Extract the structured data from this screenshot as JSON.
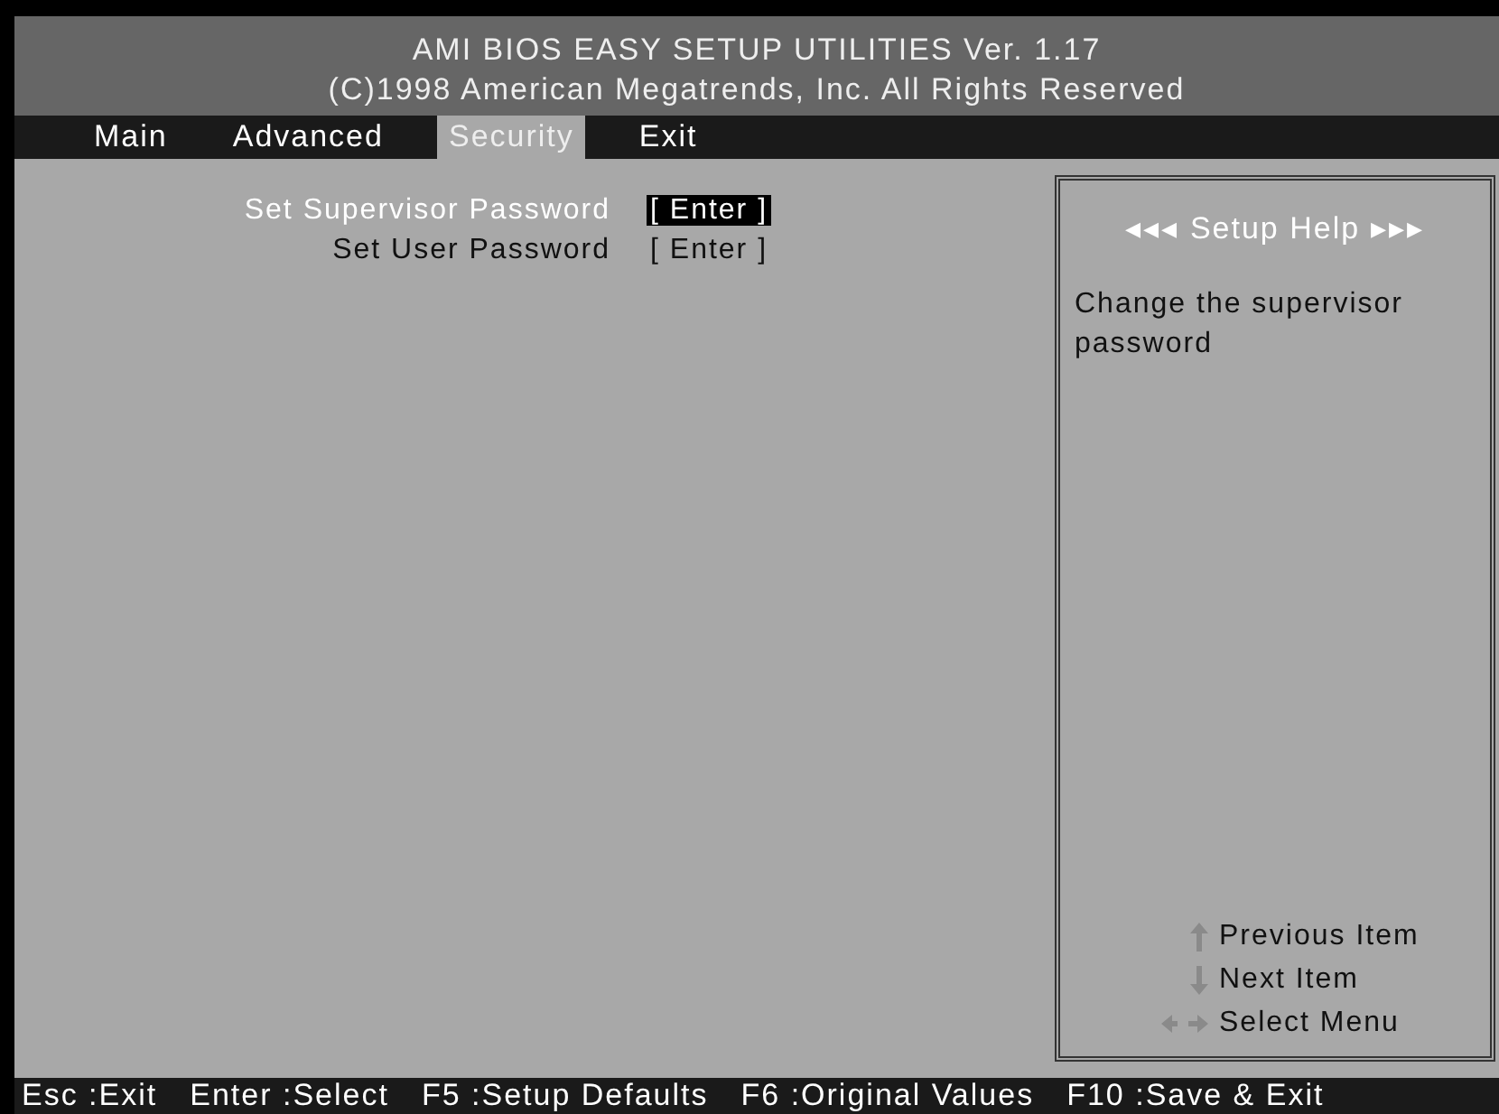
{
  "header": {
    "title": "AMI BIOS EASY SETUP UTILITIES Ver. 1.17",
    "copyright": "(C)1998 American Megatrends, Inc. All Rights Reserved"
  },
  "tabs": [
    {
      "label": "Main",
      "selected": false
    },
    {
      "label": "Advanced",
      "selected": false
    },
    {
      "label": "Security",
      "selected": true
    },
    {
      "label": "Exit",
      "selected": false
    }
  ],
  "items": [
    {
      "label": "Set Supervisor Password",
      "value": "[ Enter ]",
      "selected": true
    },
    {
      "label": "Set User Password",
      "value": "[ Enter ]",
      "selected": false
    }
  ],
  "help": {
    "title": "◂◂◂ Setup Help ▸▸▸",
    "text": "Change the supervisor password",
    "keys": [
      {
        "kind": "up",
        "label": "Previous Item"
      },
      {
        "kind": "down",
        "label": "Next Item"
      },
      {
        "kind": "leftright",
        "label": "Select Menu"
      }
    ]
  },
  "status_bar": [
    "Esc :Exit",
    "Enter :Select",
    "F5 :Setup Defaults",
    "F6 :Original Values",
    "F10 :Save & Exit"
  ]
}
